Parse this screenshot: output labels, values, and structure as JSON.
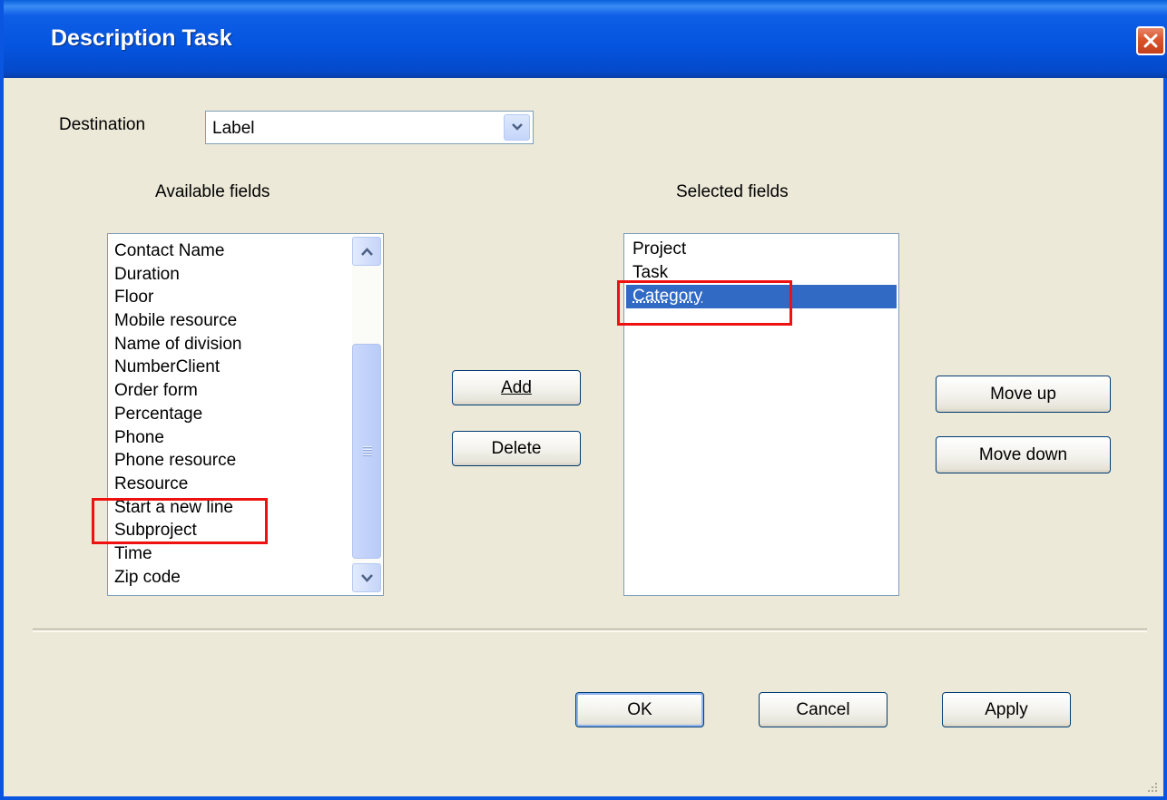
{
  "window": {
    "title": "Description Task"
  },
  "destination": {
    "label": "Destination",
    "value": "Label"
  },
  "available": {
    "header": "Available fields",
    "items": [
      "Contact Name",
      "Duration",
      "Floor",
      "Mobile resource",
      "Name of division",
      "NumberClient",
      "Order form",
      "Percentage",
      "Phone",
      "Phone resource",
      "Resource",
      "Start a new line",
      "Subproject",
      "Time",
      "Zip code"
    ]
  },
  "selected": {
    "header": "Selected fields",
    "items": [
      "Project",
      "Task",
      "Category"
    ],
    "selected_item": "Category"
  },
  "buttons": {
    "add": "Add",
    "delete": "Delete",
    "move_up": "Move up",
    "move_down": "Move down",
    "ok": "OK",
    "cancel": "Cancel",
    "apply": "Apply"
  },
  "annotations": [
    "Subproject",
    "Category"
  ],
  "colors": {
    "titlebar": "#0554df",
    "selection": "#316ac5",
    "highlight": "#ee1111",
    "face": "#ece9d8"
  }
}
